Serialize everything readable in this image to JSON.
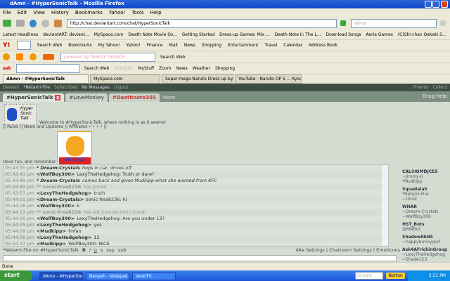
{
  "window": {
    "title": "dAmn - #HyperSonicTalk - Mozilla Firefox"
  },
  "menu": [
    "File",
    "Edit",
    "View",
    "History",
    "Bookmarks",
    "Yahoo!",
    "Tools",
    "Help"
  ],
  "nav": {
    "url": "http://chat.deviantart.com/chat/HyperSonicTalk",
    "search_placeholder": "Yahoo"
  },
  "bookmarks": [
    "Latest Headlines",
    "deviantART: deviant...",
    "MySpace.com",
    "Death Note Movie Ov...",
    "Getting Started",
    "Dress-up Games: Mix ...",
    "Death Note II: The L...",
    "Download Songs",
    "Aeria Games",
    "(C)Shi-chan Oekaki S..."
  ],
  "yahoo_bar": [
    "Search Web",
    "Bookmarks",
    "My Yahoo!",
    "Yahoo!",
    "Finance",
    "Mail",
    "News",
    "Shopping",
    "Entertainment",
    "Travel",
    "Calendar",
    "Address Book"
  ],
  "yahoo_bar2": {
    "search_placeholder": "powered by YAHOO! SEARCH",
    "search": "Search Web"
  },
  "ask_bar": [
    "Search Web",
    "Highlight",
    "MyStuff",
    "Zoom",
    "News",
    "Weather",
    "Shopping"
  ],
  "tabs": [
    "dAmn - #HyperSonicTalk",
    "MySpace.com",
    "Super-mega Naruto Dress up by ~Cha...",
    "YouTube - Naruto OP 5 ... Kyousouky..."
  ],
  "dabar": {
    "items": [
      "Deviant",
      "*Netami-Fire",
      "Subscribed",
      "No Messages",
      "Logout"
    ],
    "right": [
      "Friends",
      "Collect"
    ]
  },
  "chat": {
    "tabs": [
      "#HyperSonicTalk",
      "#LoveMonkey",
      "#Deathnote355",
      "More"
    ],
    "drag": "Drag",
    "help": "Help",
    "logo_text": "Hyper Sonic Talk",
    "welcome": "Welcome to #HyperSonicTalk, where nothing is as it seems!",
    "links": "|| Rules || News and Updates || Affiliates • • • • ||",
    "badge": "TAILSKO",
    "remember": "Have fun, and remember -",
    "messages": [
      {
        "time": "05:43:35 pm",
        "nick": "* Dream-Crystals",
        "text": "hops in car, drives off",
        "type": "action"
      },
      {
        "time": "05:43:41 pm",
        "nick": "<WolfBoy300>",
        "text": "LexyTheHedgehog: Truth or dare?",
        "type": "msg"
      },
      {
        "time": "05:43:49 pm",
        "nick": "* Dream-Crystals",
        "text": "comes back and gives Mudkipp what she wanted from KFC",
        "type": "action"
      },
      {
        "time": "05:43:49 pm",
        "nick": "** sonic-freak236",
        "text": "has joined",
        "type": "sys"
      },
      {
        "time": "05:43:53 pm",
        "nick": "<LexyTheHedgehog>",
        "text": "truth",
        "type": "msg"
      },
      {
        "time": "05:44:01 pm",
        "nick": "<Dream-Crystals>",
        "text": "sonic-freak236: hi",
        "type": "msg"
      },
      {
        "time": "05:44:08 pm",
        "nick": "<WolfBoy300>",
        "text": "k",
        "type": "msg"
      },
      {
        "time": "05:44:13 pm",
        "nick": "** sonic-freak236",
        "text": "has left [connection closed]",
        "type": "sys"
      },
      {
        "time": "05:44:16 pm",
        "nick": "<WolfBoy300>",
        "text": "LexyTheHedgehog: Are you under 13?",
        "type": "msg"
      },
      {
        "time": "05:44:25 pm",
        "nick": "<LexyTheHedgehog>",
        "text": "yes",
        "type": "msg"
      },
      {
        "time": "05:44:28 pm",
        "nick": "<Mudkipp>",
        "text": "lmfao",
        "type": "msg"
      },
      {
        "time": "05:44:28 pm",
        "nick": "<LexyTheHedgehog>",
        "text": "12",
        "type": "msg"
      },
      {
        "time": "05:44:37 pm",
        "nick": "<Mudkipp>",
        "text": "WolfBoy300: NICE",
        "type": "msg"
      }
    ],
    "users": [
      {
        "group": "CALSIOMDJCES",
        "members": [
          "~jimmy-o",
          "*Mudkipp"
        ]
      },
      {
        "group": "Squadalah",
        "members": [
          "*Netami-Fire",
          "~UnoZ"
        ]
      },
      {
        "group": "WHAR",
        "members": [
          "~Dream-Crystals",
          "~WolfBoy300"
        ]
      },
      {
        "group": "HST_Bots",
        "members": [
          "@MNBot"
        ]
      },
      {
        "group": "ShadowFANS",
        "members": [
          "~happybunnygurl"
        ]
      },
      {
        "group": "Ask4AFrickinGroup",
        "members": [
          "~LexyTheHedgehog",
          "~Shade123"
        ]
      }
    ],
    "input_label": "*Netami-Fire on #HyperSonicTalk",
    "format_buttons": [
      "B",
      "i",
      "u",
      "s",
      "sup",
      "sub"
    ],
    "settings": "dAx Settings | Chatroom Settings | Emoticons"
  },
  "status": "Done",
  "taskbar": {
    "start": "start",
    "tasks": [
      "dAmn - #HyperSonic...",
      "Nenyeh - Notepad",
      "VeohTV"
    ],
    "norton": "Norton",
    "search": "Google",
    "clock": "5:51 PM"
  }
}
